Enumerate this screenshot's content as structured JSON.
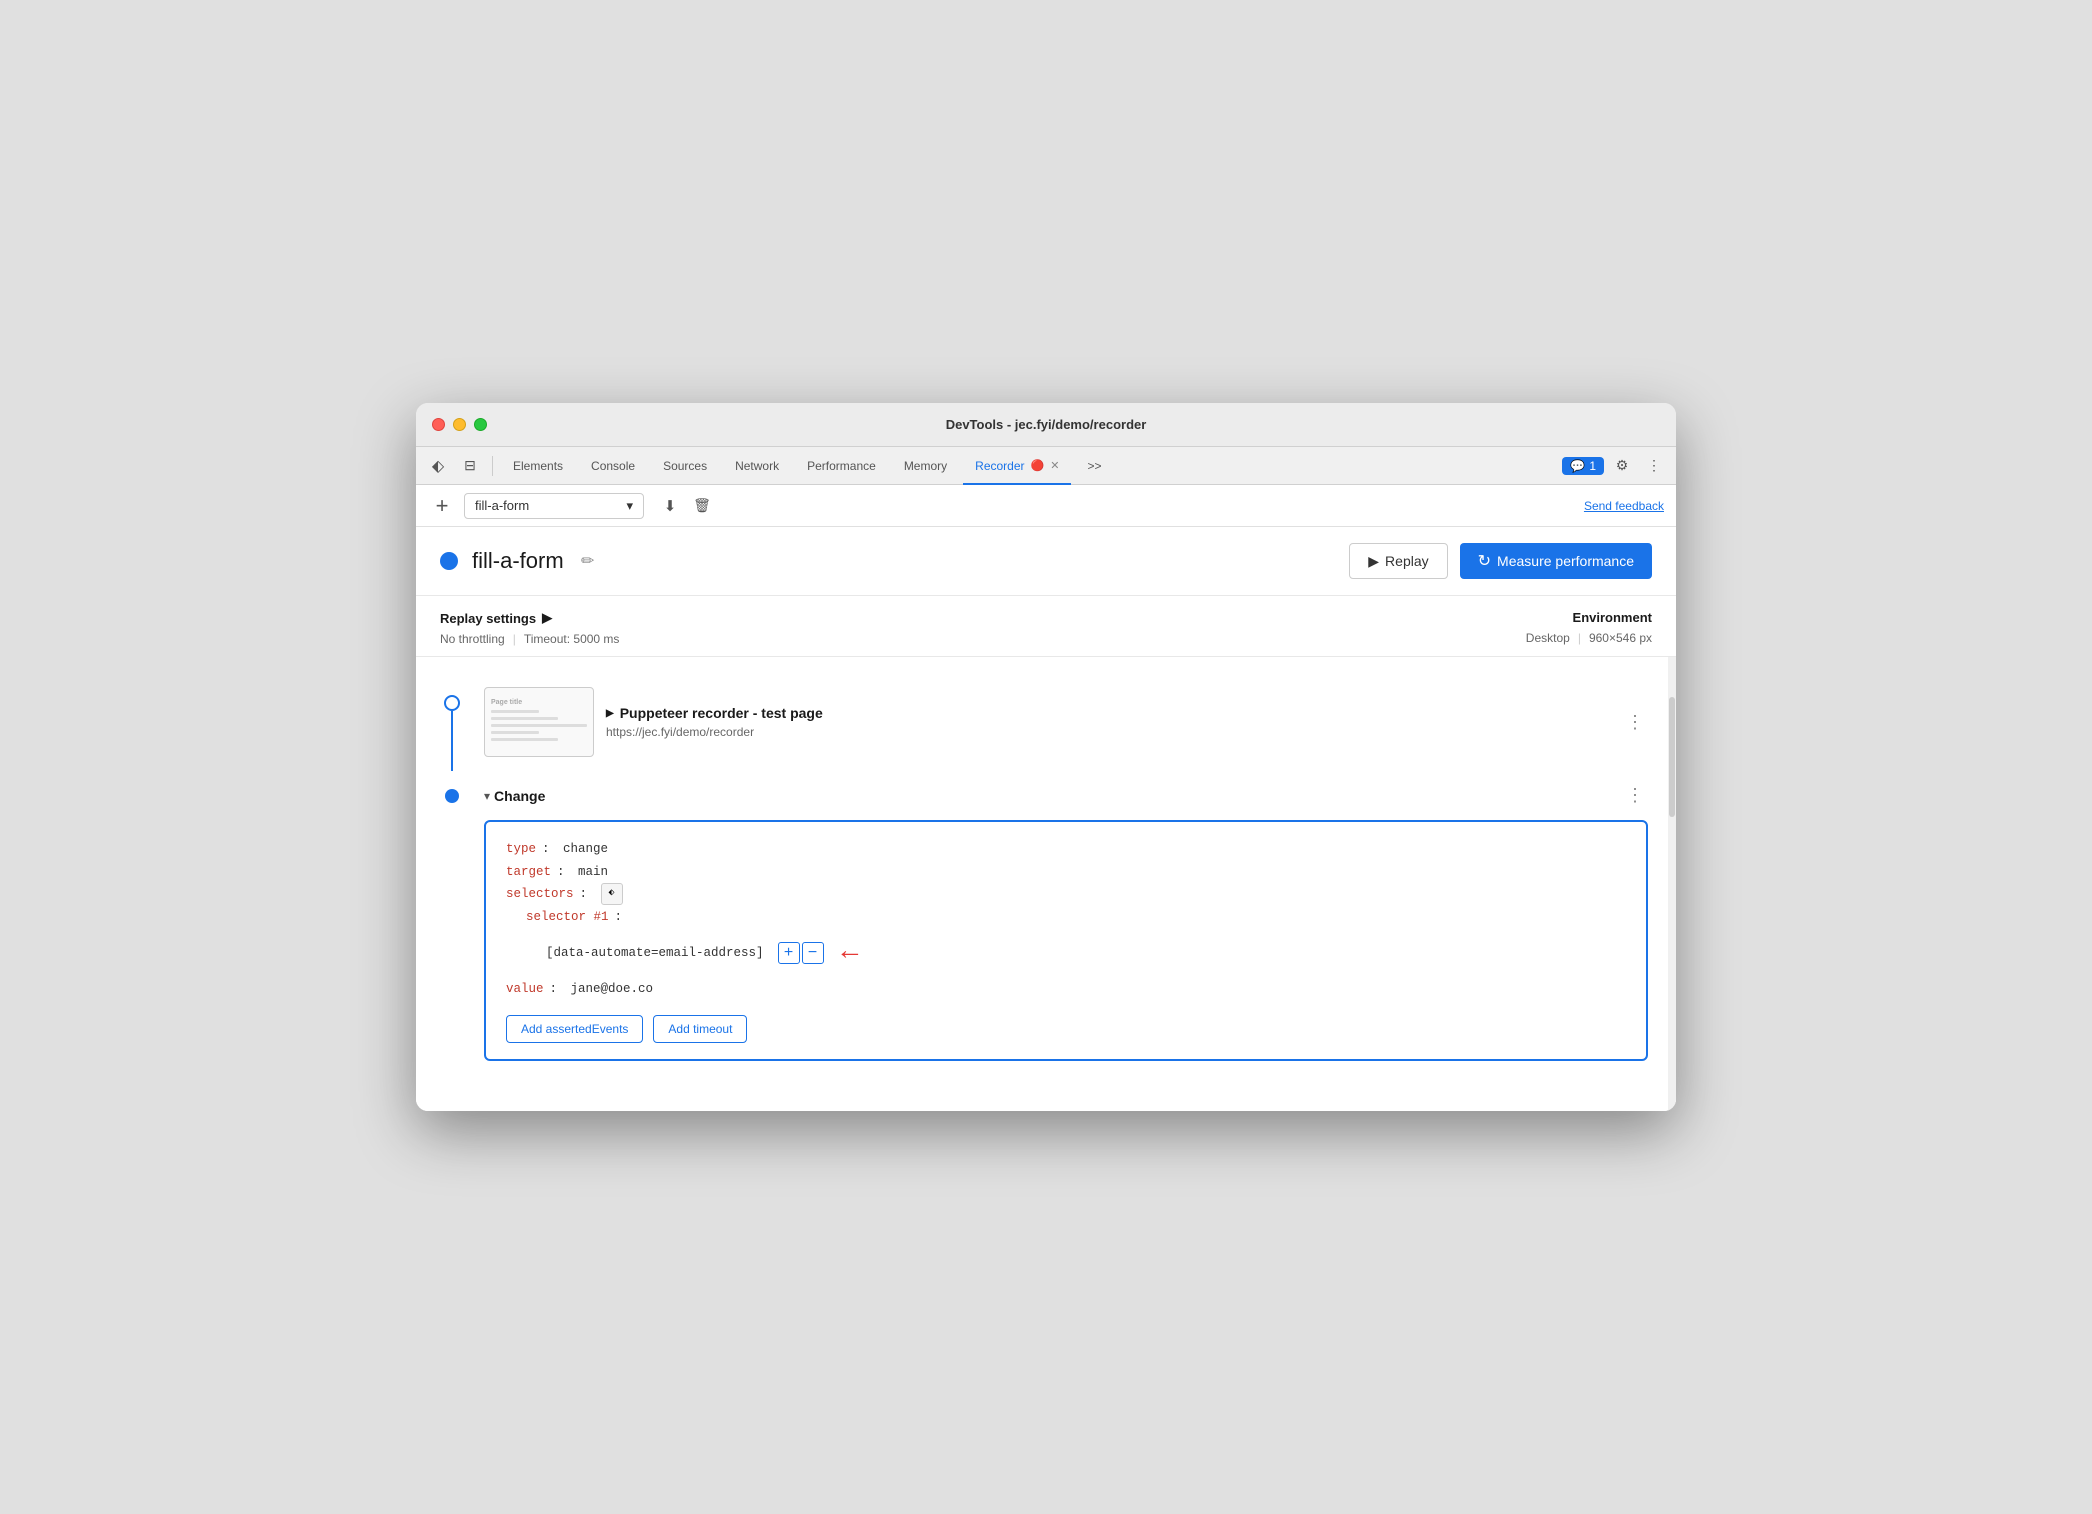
{
  "window": {
    "title": "DevTools - jec.fyi/demo/recorder"
  },
  "tabs": [
    {
      "id": "elements",
      "label": "Elements",
      "active": false
    },
    {
      "id": "console",
      "label": "Console",
      "active": false
    },
    {
      "id": "sources",
      "label": "Sources",
      "active": false
    },
    {
      "id": "network",
      "label": "Network",
      "active": false
    },
    {
      "id": "performance",
      "label": "Performance",
      "active": false
    },
    {
      "id": "memory",
      "label": "Memory",
      "active": false
    },
    {
      "id": "recorder",
      "label": "Recorder",
      "active": true
    }
  ],
  "toolbar": {
    "add_label": "+",
    "recording_name": "fill-a-form",
    "send_feedback": "Send feedback"
  },
  "recording": {
    "dot_color": "#1a73e8",
    "name": "fill-a-form",
    "replay_label": "Replay",
    "measure_label": "Measure performance"
  },
  "settings": {
    "title": "Replay settings",
    "throttling": "No throttling",
    "timeout": "Timeout: 5000 ms",
    "environment_title": "Environment",
    "env_type": "Desktop",
    "env_size": "960×546 px"
  },
  "steps": {
    "navigate": {
      "title": "Puppeteer recorder - test page",
      "url": "https://jec.fyi/demo/recorder",
      "more_icon": "⋮"
    },
    "change": {
      "title": "Change",
      "more_icon": "⋮",
      "code": {
        "type_key": "type",
        "type_val": "change",
        "target_key": "target",
        "target_val": "main",
        "selectors_key": "selectors",
        "selector_num_key": "selector #1",
        "selector_val": "[data-automate=email-address]",
        "value_key": "value",
        "value_val": "jane@doe.co"
      },
      "add_events_btn": "Add assertedEvents",
      "add_timeout_btn": "Add timeout"
    }
  },
  "chat_badge": "1",
  "icons": {
    "cursor": "⬖",
    "layers": "⊟",
    "chevron": "▾",
    "download": "⬇",
    "trash": "🗑",
    "pencil": "✏",
    "play": "▶",
    "measure": "↻",
    "triangle_right": "▶",
    "triangle_down": "▾",
    "more": "⋮",
    "plus": "+",
    "minus": "−",
    "more_horiz": "»"
  }
}
